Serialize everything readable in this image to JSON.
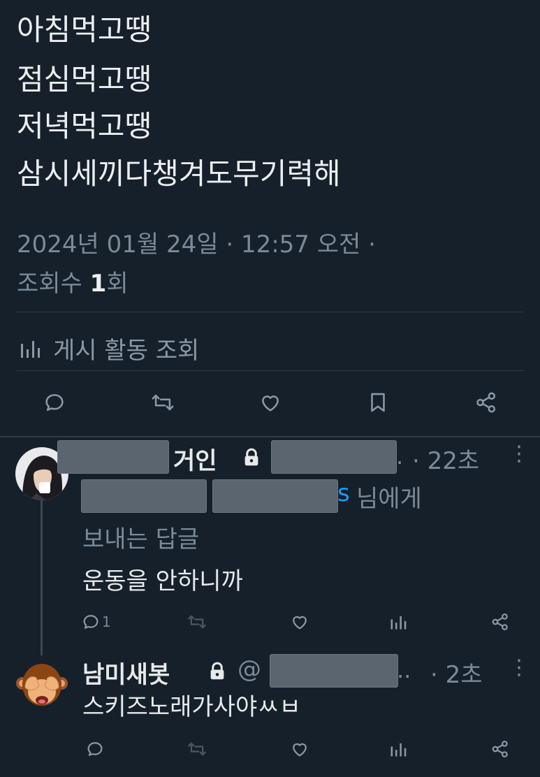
{
  "tweet": {
    "lines": [
      "아침먹고땡",
      "점심먹고땡",
      "저녁먹고땡",
      "삼시세끼다챙겨도무기력해"
    ],
    "timestamp": "2024년 01월 24일 · 12:57 오전 ·",
    "views_prefix": "조회수",
    "views_count": "1",
    "views_suffix": "회",
    "activity_label": "게시 활동 조회"
  },
  "actions": [
    {
      "icon": "reply-icon"
    },
    {
      "icon": "retweet-icon"
    },
    {
      "icon": "like-icon"
    },
    {
      "icon": "bookmark-icon"
    },
    {
      "icon": "share-icon"
    }
  ],
  "replies": [
    {
      "name_suffix": "거인",
      "handle_tail": ".",
      "time": "· 22초",
      "reply_to_tail": "s",
      "reply_to_suffix": "님에게",
      "reply_to_line2": "보내는 답글",
      "text": "운동을 안하니까",
      "reply_count": "1"
    },
    {
      "name": "남미새봇",
      "handle_prefix": "@",
      "handle_tail": "..",
      "time": "· 2초",
      "text": "스키즈노래가사야ㅆㅂ"
    }
  ],
  "colors": {
    "background": "#15202b",
    "text": "#e7e9ea",
    "muted": "#7b8a98",
    "link": "#1d9bf0"
  }
}
